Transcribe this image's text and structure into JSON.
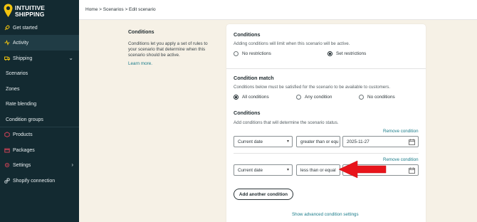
{
  "brand": {
    "name_line1": "INTUITIVE",
    "name_line2": "SHIPPING",
    "accent": "#f2c40f"
  },
  "sidebar": {
    "items": [
      {
        "label": "Get started",
        "icon": "rocket-icon"
      },
      {
        "label": "Activity",
        "icon": "activity-icon"
      },
      {
        "label": "Shipping",
        "icon": "truck-icon"
      },
      {
        "label": "Scenarios"
      },
      {
        "label": "Zones"
      },
      {
        "label": "Rate blending"
      },
      {
        "label": "Condition groups"
      },
      {
        "label": "Products",
        "icon": "products-icon"
      },
      {
        "label": "Packages",
        "icon": "packages-icon"
      },
      {
        "label": "Settings",
        "icon": "gear-icon"
      },
      {
        "label": "Shopify connection",
        "icon": "link-icon"
      }
    ]
  },
  "breadcrumb": "Home > Scenarios > Edit scenario",
  "description": {
    "title": "Conditions",
    "text": "Conditions let you apply a set of rules to your scenario that determine when this scenario should be active.",
    "link": "Learn more."
  },
  "conditions_section": {
    "title": "Conditions",
    "subtitle": "Adding conditions will limit when this scenario will be active.",
    "options": [
      "No restrictions",
      "Set restrictions"
    ],
    "selected": "Set restrictions"
  },
  "match_section": {
    "title": "Condition match",
    "subtitle": "Conditions below must be satisfied for the scenario to be available to customers.",
    "options": [
      "All conditions",
      "Any condition",
      "No conditions"
    ],
    "selected": "All conditions"
  },
  "rules_section": {
    "title": "Conditions",
    "subtitle": "Add conditions that will determine the scenario status.",
    "remove_label": "Remove condition",
    "rows": [
      {
        "field": "Current date",
        "operator": "greater than or equ",
        "value": "2025-11-27"
      },
      {
        "field": "Current date",
        "operator": "less than or equal",
        "value": ""
      }
    ],
    "add_label": "Add another condition",
    "advanced_label": "Show advanced condition settings"
  },
  "annotation": {
    "arrow_color": "#e8141b"
  }
}
